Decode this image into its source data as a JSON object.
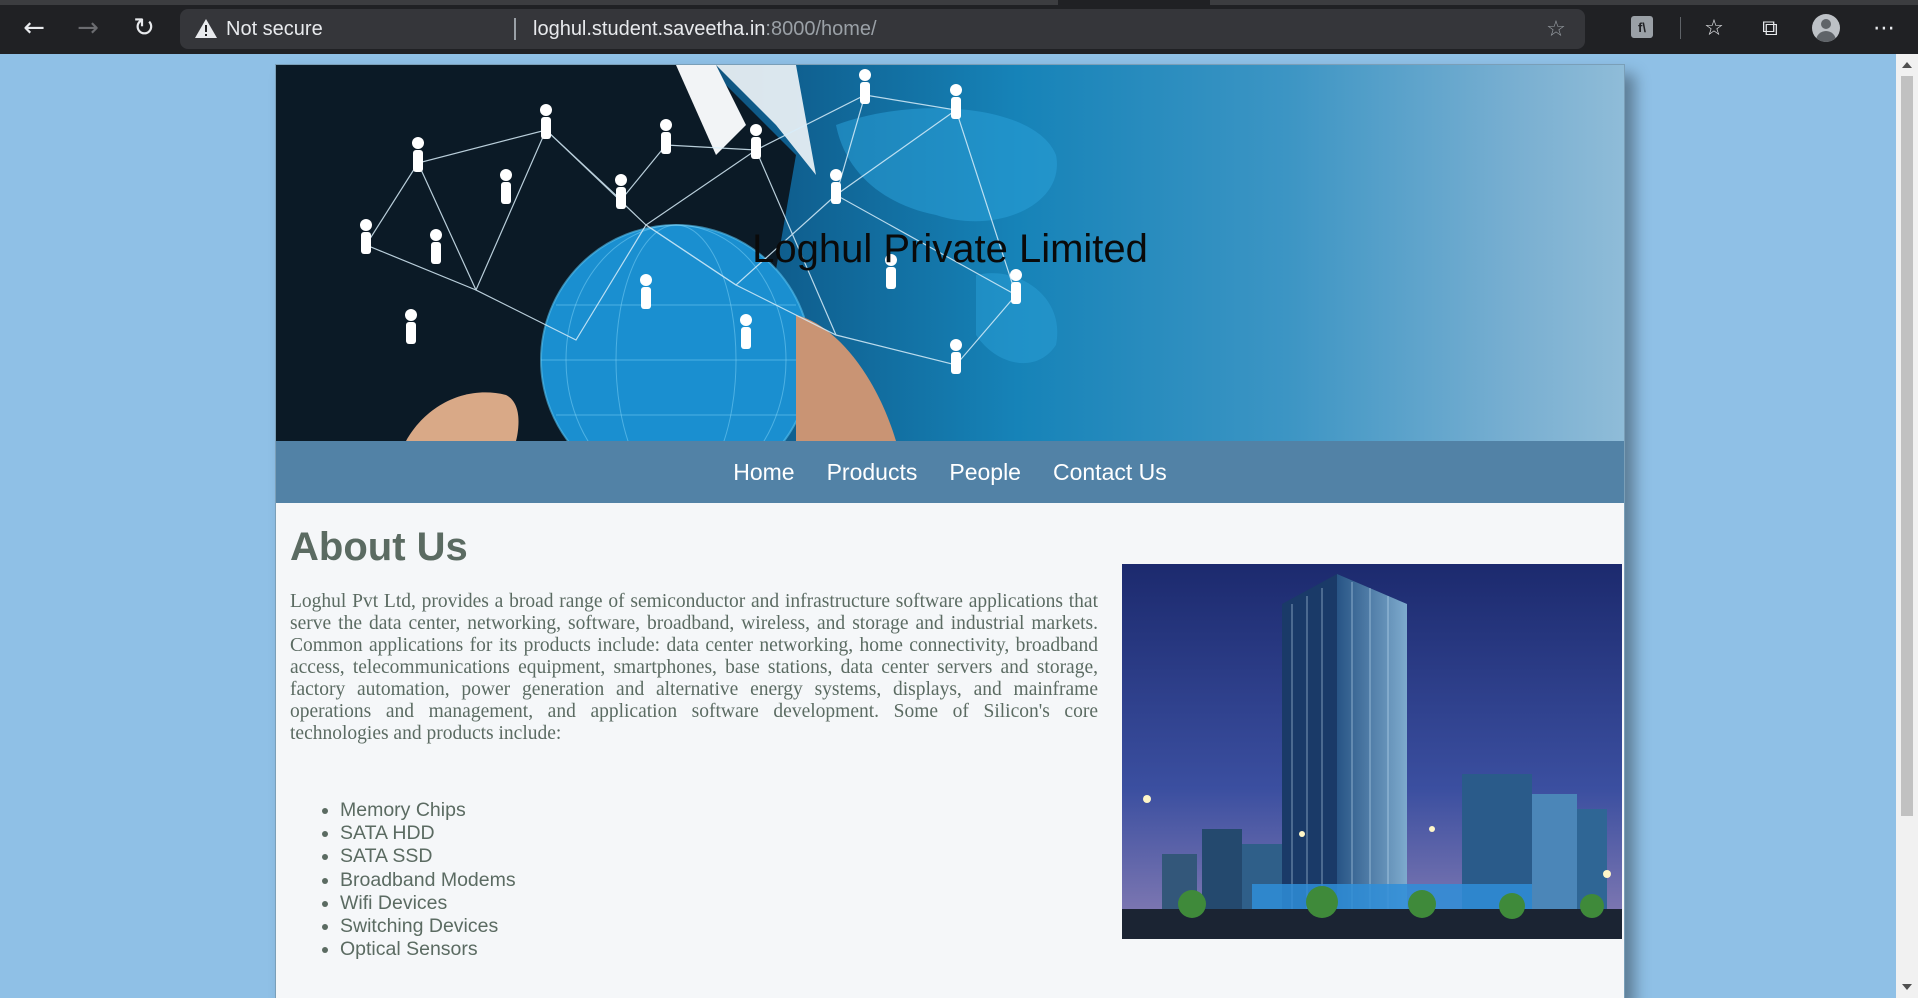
{
  "browser": {
    "nav": {
      "back_icon": "back-arrow-icon",
      "forward_icon": "forward-arrow-icon",
      "reload_icon": "reload-icon"
    },
    "security_label": "Not secure",
    "url_host": "loghul.student.saveetha.in",
    "url_rest": ":8000/home/",
    "toolbar_icons": [
      "add-favorite-icon",
      "extension-icon",
      "favorites-icon",
      "collections-icon",
      "profile-avatar",
      "more-menu-icon"
    ]
  },
  "site": {
    "banner_title": "Loghul Private Limited",
    "nav": [
      "Home",
      "Products",
      "People",
      "Contact Us"
    ]
  },
  "about": {
    "title": "About Us",
    "paragraph": "Loghul Pvt Ltd, provides a broad range of semiconductor and infrastructure software applications that serve the data center, networking, software, broadband, wireless, and storage and industrial markets. Common applications for its products include: data center networking, home connectivity, broadband access, telecommunications equipment, smartphones, base stations, data center servers and storage, factory automation, power generation and alternative energy systems, displays, and mainframe operations and management, and application software development. Some of Silicon's core technologies and products include:",
    "products": [
      "Memory Chips",
      "SATA HDD",
      "SATA SSD",
      "Broadband Modems",
      "Wifi Devices",
      "Switching Devices",
      "Optical Sensors"
    ]
  },
  "colors": {
    "page_bg": "#8fc0e6",
    "nav_bg": "#5282a6",
    "text": "#5b6b62"
  }
}
